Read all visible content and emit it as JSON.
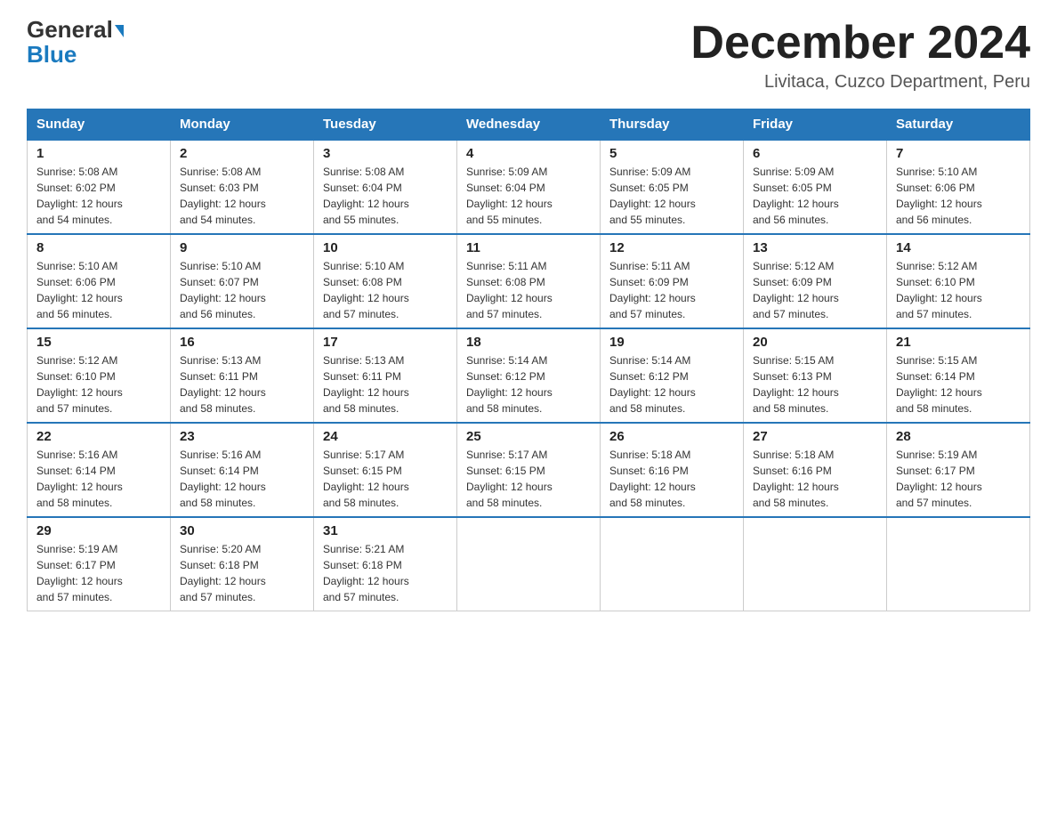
{
  "header": {
    "logo_line1": "General",
    "logo_line2": "Blue",
    "main_title": "December 2024",
    "subtitle": "Livitaca, Cuzco Department, Peru"
  },
  "days_of_week": [
    "Sunday",
    "Monday",
    "Tuesday",
    "Wednesday",
    "Thursday",
    "Friday",
    "Saturday"
  ],
  "weeks": [
    [
      {
        "day": "1",
        "sunrise": "5:08 AM",
        "sunset": "6:02 PM",
        "daylight": "12 hours and 54 minutes."
      },
      {
        "day": "2",
        "sunrise": "5:08 AM",
        "sunset": "6:03 PM",
        "daylight": "12 hours and 54 minutes."
      },
      {
        "day": "3",
        "sunrise": "5:08 AM",
        "sunset": "6:04 PM",
        "daylight": "12 hours and 55 minutes."
      },
      {
        "day": "4",
        "sunrise": "5:09 AM",
        "sunset": "6:04 PM",
        "daylight": "12 hours and 55 minutes."
      },
      {
        "day": "5",
        "sunrise": "5:09 AM",
        "sunset": "6:05 PM",
        "daylight": "12 hours and 55 minutes."
      },
      {
        "day": "6",
        "sunrise": "5:09 AM",
        "sunset": "6:05 PM",
        "daylight": "12 hours and 56 minutes."
      },
      {
        "day": "7",
        "sunrise": "5:10 AM",
        "sunset": "6:06 PM",
        "daylight": "12 hours and 56 minutes."
      }
    ],
    [
      {
        "day": "8",
        "sunrise": "5:10 AM",
        "sunset": "6:06 PM",
        "daylight": "12 hours and 56 minutes."
      },
      {
        "day": "9",
        "sunrise": "5:10 AM",
        "sunset": "6:07 PM",
        "daylight": "12 hours and 56 minutes."
      },
      {
        "day": "10",
        "sunrise": "5:10 AM",
        "sunset": "6:08 PM",
        "daylight": "12 hours and 57 minutes."
      },
      {
        "day": "11",
        "sunrise": "5:11 AM",
        "sunset": "6:08 PM",
        "daylight": "12 hours and 57 minutes."
      },
      {
        "day": "12",
        "sunrise": "5:11 AM",
        "sunset": "6:09 PM",
        "daylight": "12 hours and 57 minutes."
      },
      {
        "day": "13",
        "sunrise": "5:12 AM",
        "sunset": "6:09 PM",
        "daylight": "12 hours and 57 minutes."
      },
      {
        "day": "14",
        "sunrise": "5:12 AM",
        "sunset": "6:10 PM",
        "daylight": "12 hours and 57 minutes."
      }
    ],
    [
      {
        "day": "15",
        "sunrise": "5:12 AM",
        "sunset": "6:10 PM",
        "daylight": "12 hours and 57 minutes."
      },
      {
        "day": "16",
        "sunrise": "5:13 AM",
        "sunset": "6:11 PM",
        "daylight": "12 hours and 58 minutes."
      },
      {
        "day": "17",
        "sunrise": "5:13 AM",
        "sunset": "6:11 PM",
        "daylight": "12 hours and 58 minutes."
      },
      {
        "day": "18",
        "sunrise": "5:14 AM",
        "sunset": "6:12 PM",
        "daylight": "12 hours and 58 minutes."
      },
      {
        "day": "19",
        "sunrise": "5:14 AM",
        "sunset": "6:12 PM",
        "daylight": "12 hours and 58 minutes."
      },
      {
        "day": "20",
        "sunrise": "5:15 AM",
        "sunset": "6:13 PM",
        "daylight": "12 hours and 58 minutes."
      },
      {
        "day": "21",
        "sunrise": "5:15 AM",
        "sunset": "6:14 PM",
        "daylight": "12 hours and 58 minutes."
      }
    ],
    [
      {
        "day": "22",
        "sunrise": "5:16 AM",
        "sunset": "6:14 PM",
        "daylight": "12 hours and 58 minutes."
      },
      {
        "day": "23",
        "sunrise": "5:16 AM",
        "sunset": "6:14 PM",
        "daylight": "12 hours and 58 minutes."
      },
      {
        "day": "24",
        "sunrise": "5:17 AM",
        "sunset": "6:15 PM",
        "daylight": "12 hours and 58 minutes."
      },
      {
        "day": "25",
        "sunrise": "5:17 AM",
        "sunset": "6:15 PM",
        "daylight": "12 hours and 58 minutes."
      },
      {
        "day": "26",
        "sunrise": "5:18 AM",
        "sunset": "6:16 PM",
        "daylight": "12 hours and 58 minutes."
      },
      {
        "day": "27",
        "sunrise": "5:18 AM",
        "sunset": "6:16 PM",
        "daylight": "12 hours and 58 minutes."
      },
      {
        "day": "28",
        "sunrise": "5:19 AM",
        "sunset": "6:17 PM",
        "daylight": "12 hours and 57 minutes."
      }
    ],
    [
      {
        "day": "29",
        "sunrise": "5:19 AM",
        "sunset": "6:17 PM",
        "daylight": "12 hours and 57 minutes."
      },
      {
        "day": "30",
        "sunrise": "5:20 AM",
        "sunset": "6:18 PM",
        "daylight": "12 hours and 57 minutes."
      },
      {
        "day": "31",
        "sunrise": "5:21 AM",
        "sunset": "6:18 PM",
        "daylight": "12 hours and 57 minutes."
      },
      null,
      null,
      null,
      null
    ]
  ],
  "labels": {
    "sunrise": "Sunrise:",
    "sunset": "Sunset:",
    "daylight": "Daylight:"
  }
}
